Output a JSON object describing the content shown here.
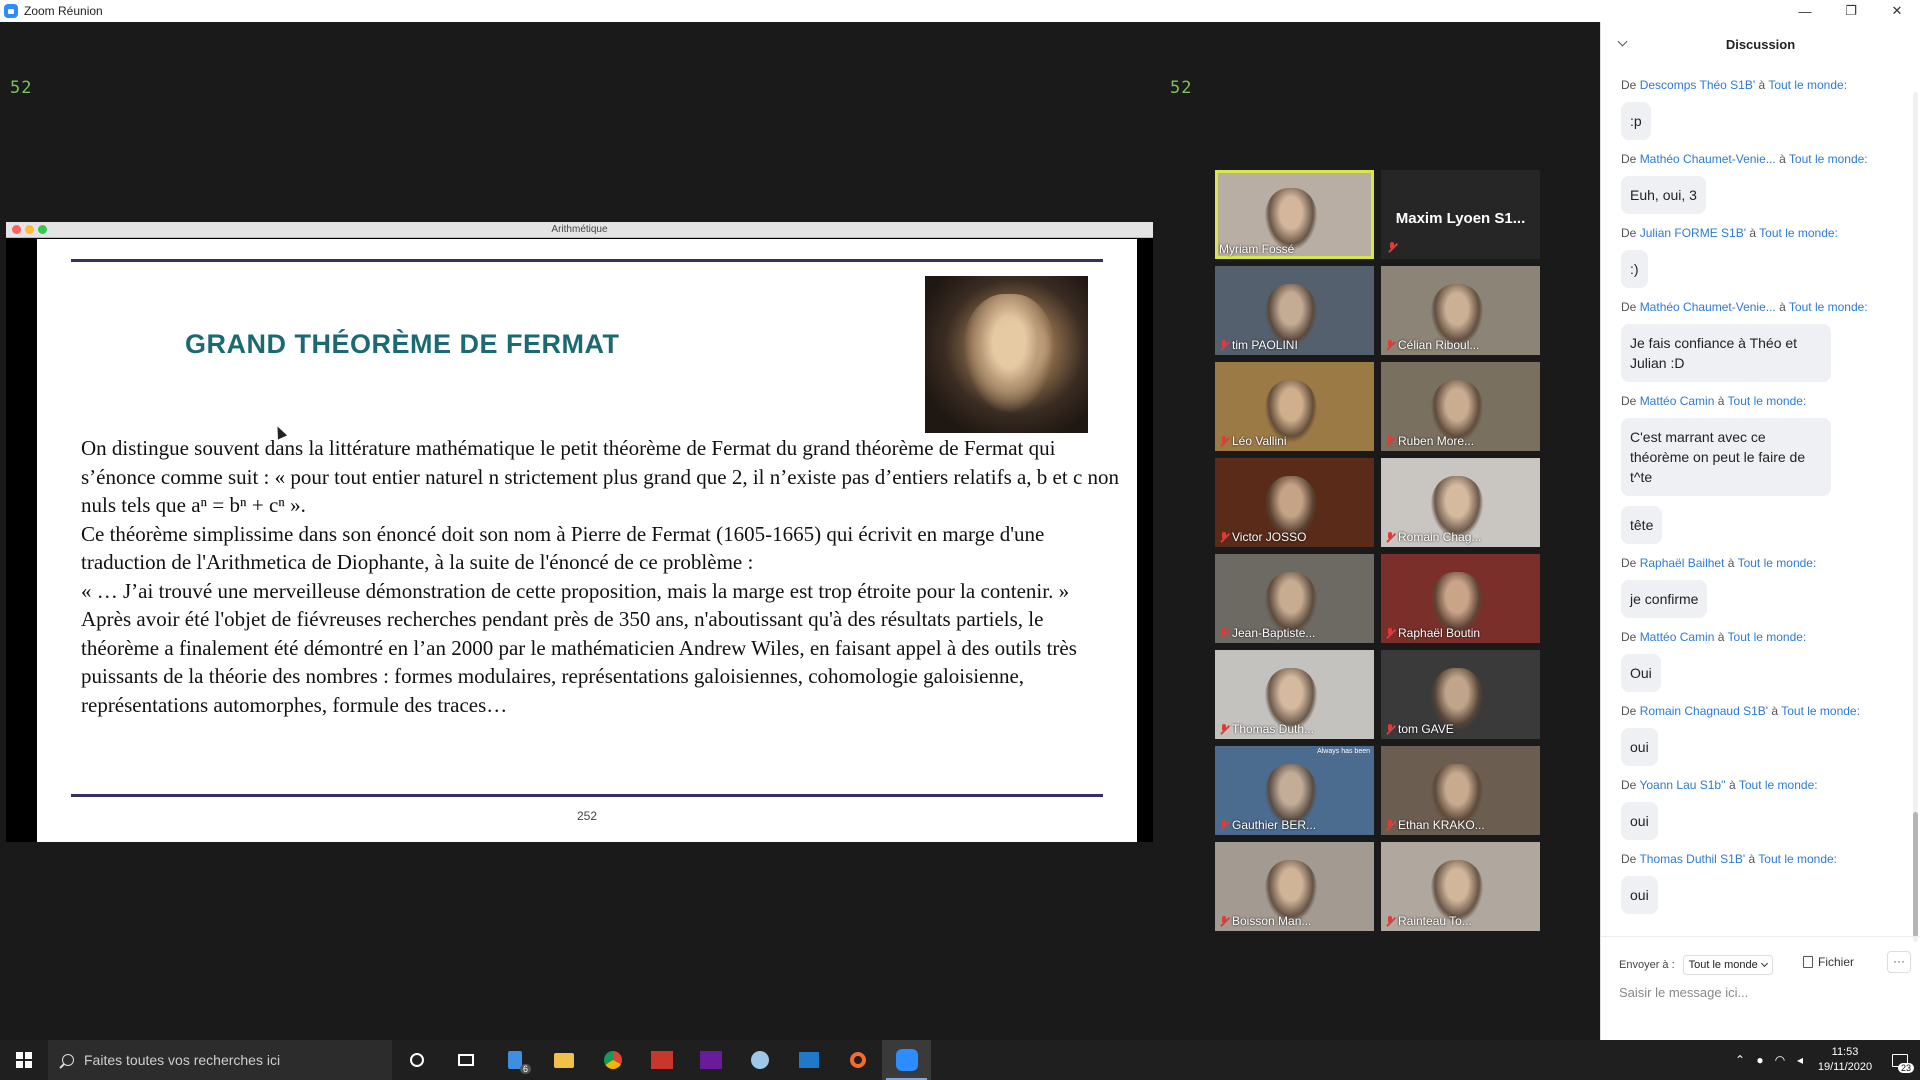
{
  "window": {
    "title": "Zoom Réunion",
    "minimize": "—",
    "restore": "❐",
    "close": "✕"
  },
  "meeting": {
    "counter_left": "52",
    "counter_right": "52"
  },
  "share": {
    "doc_title": "Arithmétique",
    "slide": {
      "title": "GRAND THÉORÈME DE FERMAT",
      "paragraphs": [
        "On distingue souvent dans la littérature mathématique le petit théorème de Fermat du grand théorème de Fermat qui s’énonce comme suit : « pour tout entier naturel n strictement plus grand que 2, il n’existe pas d’entiers relatifs a, b et c non nuls tels que aⁿ = bⁿ + cⁿ ».",
        "Ce théorème simplissime dans son énoncé doit son nom à Pierre de Fermat (1605-1665) qui écrivit en marge d'une traduction de l'Arithmetica de Diophante, à la suite de l'énoncé de ce problème :",
        "« … J’ai trouvé une merveilleuse démonstration de cette proposition, mais la marge est trop étroite pour la contenir. »",
        "Après avoir été l'objet de fiévreuses recherches pendant près de 350 ans, n'aboutissant qu'à des résultats partiels, le théorème a finalement été démontré en l’an 2000 par le mathématicien Andrew Wiles, en faisant appel à des outils très puissants de la théorie des nombres : formes modulaires, représentations galoisiennes, cohomologie galoisienne, représentations automorphes, formule des traces…"
      ],
      "page": "252"
    }
  },
  "gallery": {
    "tiles": [
      {
        "name": "Myriam Fossé",
        "muted": false,
        "speaker": true,
        "bg": "#b9aea4"
      },
      {
        "name": "Maxim Lyoen S1...",
        "muted": true,
        "noface": true,
        "bg": "#262626"
      },
      {
        "name": "tim PAOLINI",
        "muted": true,
        "bg": "#55606e"
      },
      {
        "name": "Célian Riboul...",
        "muted": true,
        "bg": "#8b8477"
      },
      {
        "name": "Léo Vallini",
        "muted": true,
        "bg": "#9c7a46"
      },
      {
        "name": "Ruben More...",
        "muted": true,
        "bg": "#7a7060"
      },
      {
        "name": "Victor JOSSO",
        "muted": true,
        "bg": "#5a2b18"
      },
      {
        "name": "Romain Chag...",
        "muted": true,
        "bg": "#c9c5c0"
      },
      {
        "name": "Jean-Baptiste...",
        "muted": true,
        "bg": "#6d6963"
      },
      {
        "name": "Raphaël Boutin",
        "muted": true,
        "bg": "#7a2f2a"
      },
      {
        "name": "Thomas Duth...",
        "muted": true,
        "bg": "#c4c2bf"
      },
      {
        "name": "tom GAVE",
        "muted": true,
        "bg": "#3b3a3a"
      },
      {
        "name": "Gauthier BER...",
        "muted": true,
        "bg": "#4b6b8f",
        "overlay": "Always has been"
      },
      {
        "name": "Ethan KRAKO...",
        "muted": true,
        "bg": "#6b5d50"
      },
      {
        "name": "Boisson Man...",
        "muted": true,
        "bg": "#a39b91"
      },
      {
        "name": "Rainteau To...",
        "muted": true,
        "bg": "#b0a89e"
      }
    ]
  },
  "chat": {
    "title": "Discussion",
    "messages": [
      {
        "from": "Descomps Théo S1B'",
        "to": "Tout le monde:",
        "text": ":p"
      },
      {
        "from": "Mathéo Chaumet-Venie...",
        "to": "Tout le monde:",
        "text": "Euh, oui, 3"
      },
      {
        "from": "Julian FORME S1B'",
        "to": "Tout le monde:",
        "text": ":)"
      },
      {
        "from": "Mathéo Chaumet-Venie...",
        "to": "Tout le monde:",
        "text": "Je fais confiance à Théo et Julian :D"
      },
      {
        "from": "Mattéo Camin",
        "to": "Tout le monde:",
        "text": "C'est marrant avec ce théorème on peut le faire de t^te"
      },
      {
        "extra": "tête"
      },
      {
        "from": "Raphaël Bailhet",
        "to": "Tout le monde:",
        "text": "je confirme"
      },
      {
        "from": "Mattéo Camin",
        "to": "Tout le monde:",
        "text": "Oui"
      },
      {
        "from": "Romain Chagnaud S1B'",
        "to": "Tout le monde:",
        "text": "oui"
      },
      {
        "from": "Yoann Lau S1b''",
        "to": "Tout le monde:",
        "text": "oui"
      },
      {
        "from": "Thomas Duthil S1B'",
        "to": "Tout le monde:",
        "text": "oui"
      }
    ],
    "prefix_de": "De",
    "prefix_a": "à",
    "send_to_label": "Envoyer à :",
    "send_to_value": "Tout le monde",
    "file_label": "Fichier",
    "more_label": "···",
    "input_placeholder": "Saisir le message ici..."
  },
  "taskbar": {
    "search_placeholder": "Faites toutes vos recherches ici",
    "time": "11:53",
    "date": "19/11/2020",
    "notifications": "23",
    "explorer_badge": "6",
    "accent": "#7aa7e8"
  }
}
